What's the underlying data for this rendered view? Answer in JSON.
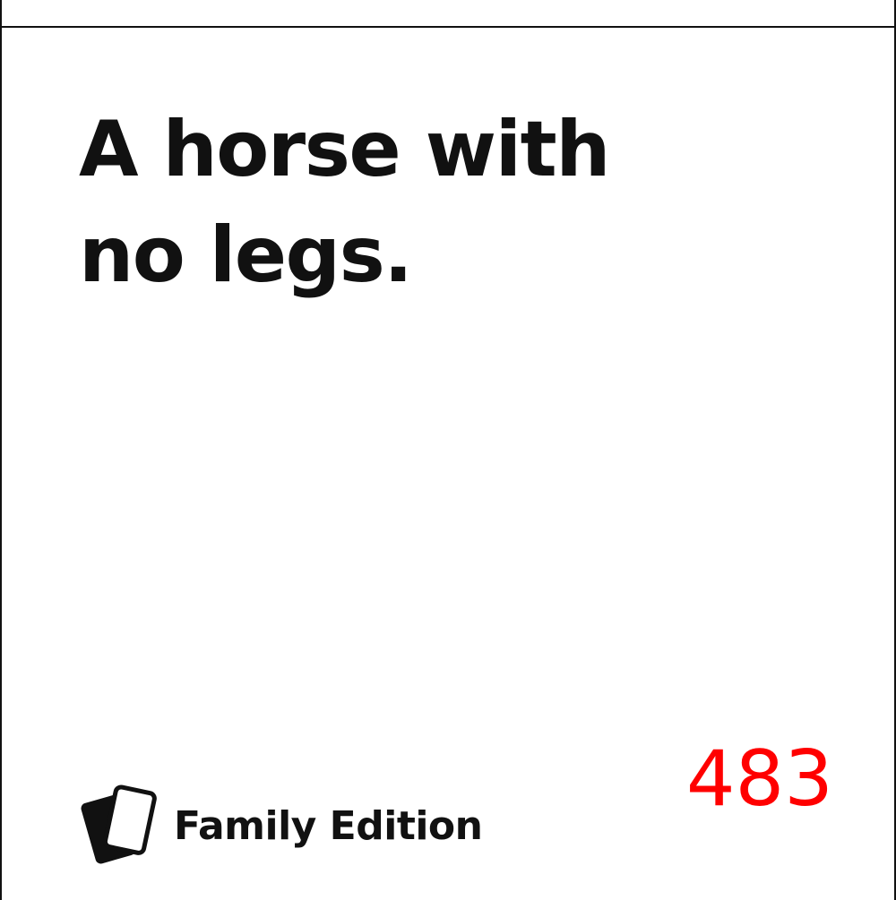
{
  "card": {
    "text_line_1": "A horse with",
    "text_line_2": "no legs.",
    "number": "483",
    "number_color": "#ff0000"
  },
  "brand": {
    "icon": "stacked-cards-icon",
    "label": "Family Edition"
  }
}
